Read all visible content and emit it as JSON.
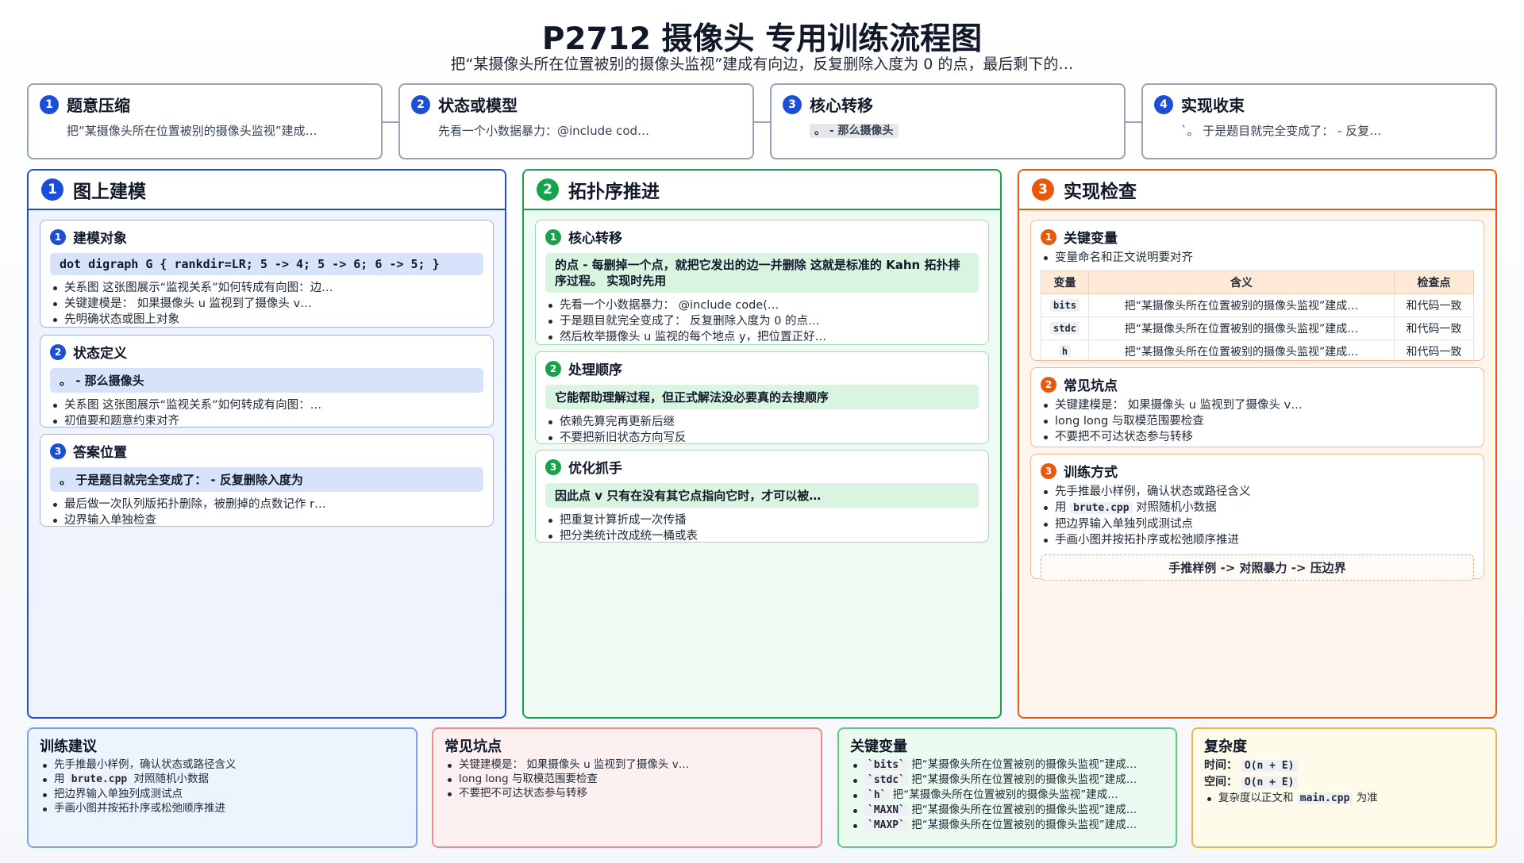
{
  "header": {
    "title": "P2712 摄像头 专用训练流程图",
    "subtitle": "把“某摄像头所在位置被别的摄像头监视”建成有向边，反复删除入度为 0 的点，最后剩下的…"
  },
  "steps": [
    {
      "num": "1",
      "title": "题意压缩",
      "desc": "把“某摄像头所在位置被别的摄像头监视”建成…"
    },
    {
      "num": "2",
      "title": "状态或模型",
      "desc": "先看一个小数据暴力：@include cod…"
    },
    {
      "num": "3",
      "title": "核心转移",
      "desc": "。 - 那么摄像头"
    },
    {
      "num": "4",
      "title": "实现收束",
      "desc": "`。 于是题目就完全变成了： - 反复…"
    }
  ],
  "columns": {
    "c1": {
      "num": "1",
      "title": "图上建模",
      "cards": [
        {
          "num": "1",
          "title": "建模对象",
          "band": "dot digraph G { rankdir=LR; 5 -> 4; 5 -> 6; 6 -> 5; }",
          "items": [
            "关系图 这张图展示“监视关系”如何转成有向图：边…",
            "关键建模是： 如果摄像头 u 监视到了摄像头 v…",
            "先明确状态或图上对象"
          ]
        },
        {
          "num": "2",
          "title": "状态定义",
          "band": "。 - 那么摄像头",
          "items": [
            "关系图 这张图展示“监视关系”如何转成有向图：…",
            "初值要和题意约束对齐"
          ]
        },
        {
          "num": "3",
          "title": "答案位置",
          "band": "。 于是题目就完全变成了： - 反复删除入度为",
          "items": [
            "最后做一次队列版拓扑删除，被删掉的点数记作 r…",
            "边界输入单独检查"
          ]
        }
      ]
    },
    "c2": {
      "num": "2",
      "title": "拓扑序推进",
      "cards": [
        {
          "num": "1",
          "title": "核心转移",
          "band": "的点 - 每删掉一个点，就把它发出的边一并删除 这就是标准的 Kahn 拓扑排序过程。 实现时先用",
          "items": [
            "先看一个小数据暴力： @include code(…",
            "于是题目就完全变成了： 反复删除入度为 0 的点…",
            "然后枚举摄像头 u 监视的每个地点 y，把位置正好…"
          ]
        },
        {
          "num": "2",
          "title": "处理顺序",
          "band": "它能帮助理解过程，但正式解法没必要真的去搜顺序",
          "items": [
            "依赖先算完再更新后继",
            "不要把新旧状态方向写反"
          ]
        },
        {
          "num": "3",
          "title": "优化抓手",
          "band": "因此点 v 只有在没有其它点指向它时，才可以被…",
          "items": [
            "把重复计算折成一次传播",
            "把分类统计改成统一桶或表"
          ]
        }
      ]
    },
    "c3": {
      "num": "3",
      "title": "实现检查",
      "card1": {
        "num": "1",
        "title": "关键变量",
        "item": "变量命名和正文说明要对齐",
        "headers": [
          "变量",
          "含义",
          "检查点"
        ],
        "rows": [
          [
            "bits",
            "把“某摄像头所在位置被别的摄像头监视”建成…",
            "和代码一致"
          ],
          [
            "stdc",
            "把“某摄像头所在位置被别的摄像头监视”建成…",
            "和代码一致"
          ],
          [
            "h",
            "把“某摄像头所在位置被别的摄像头监视”建成…",
            "和代码一致"
          ]
        ]
      },
      "card2": {
        "num": "2",
        "title": "常见坑点",
        "items": [
          "关键建模是： 如果摄像头 u 监视到了摄像头 v…",
          "long long 与取模范围要检查",
          "不要把不可达状态参与转移"
        ]
      },
      "card3": {
        "num": "3",
        "title": "训练方式",
        "items": [
          "先手推最小样例，确认状态或路径含义",
          "对照随机小数据",
          "把边界输入单独列成测试点",
          "手画小图并按拓扑序或松弛顺序推进"
        ],
        "use_prefix": "用",
        "code": "brute.cpp",
        "flow": "手推样例 -> 对照暴力 -> 压边界"
      }
    }
  },
  "bottom": {
    "b1": {
      "title": "训练建议",
      "item1": "先手推最小样例，确认状态或路径含义",
      "use_prefix": "用",
      "code": "brute.cpp",
      "item2_rest": "对照随机小数据",
      "item3": "把边界输入单独列成测试点",
      "item4": "手画小图并按拓扑序或松弛顺序推进"
    },
    "b2": {
      "title": "常见坑点",
      "items": [
        "关键建模是： 如果摄像头 u 监视到了摄像头 v…",
        "long long 与取模范围要检查",
        "不要把不可达状态参与转移"
      ]
    },
    "b3": {
      "title": "关键变量",
      "rows": [
        {
          "code": "`bits`",
          "text": "把“某摄像头所在位置被别的摄像头监视”建成…"
        },
        {
          "code": "`stdc`",
          "text": "把“某摄像头所在位置被别的摄像头监视”建成…"
        },
        {
          "code": "`h`",
          "text": "把“某摄像头所在位置被别的摄像头监视”建成…"
        },
        {
          "code": "`MAXN`",
          "text": "把“某摄像头所在位置被别的摄像头监视”建成…"
        },
        {
          "code": "`MAXP`",
          "text": "把“某摄像头所在位置被别的摄像头监视”建成…"
        }
      ]
    },
    "b4": {
      "title": "复杂度",
      "time_label": "时间：",
      "time": "O(n + E)",
      "space_label": "空间：",
      "space": "O(n + E)",
      "note_prefix": "复杂度以正文和",
      "note_code": "main.cpp",
      "note_suffix": "为准"
    }
  }
}
